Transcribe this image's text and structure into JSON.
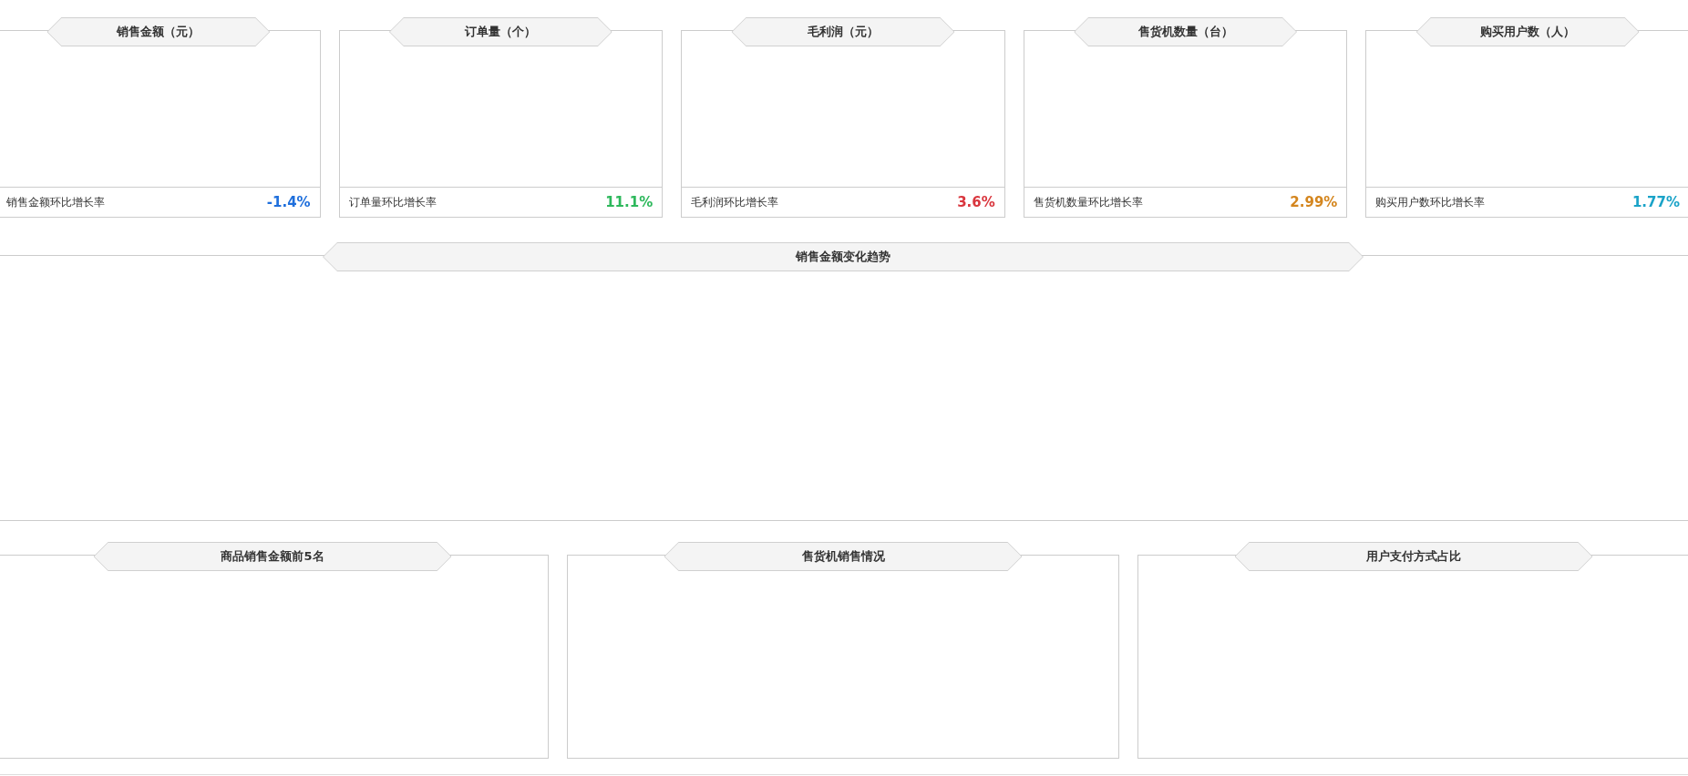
{
  "kpi_cards": [
    {
      "title": "销售金额（元）",
      "footer_label": "销售金额环比增长率",
      "growth": "-1.4%",
      "color": "#1f6fdc"
    },
    {
      "title": "订单量（个）",
      "footer_label": "订单量环比增长率",
      "growth": "11.1%",
      "color": "#2eb85c"
    },
    {
      "title": "毛利润（元）",
      "footer_label": "毛利润环比增长率",
      "growth": "3.6%",
      "color": "#d9363e"
    },
    {
      "title": "售货机数量（台）",
      "footer_label": "售货机数量环比增长率",
      "growth": "2.99%",
      "color": "#d4861f"
    },
    {
      "title": "购买用户数（人）",
      "footer_label": "购买用户数环比增长率",
      "growth": "1.77%",
      "color": "#1aa3c8"
    }
  ],
  "trend_panel": {
    "title": "销售金额变化趋势"
  },
  "bottom_panels": [
    {
      "title": "商品销售金额前5名"
    },
    {
      "title": "售货机销售情况"
    },
    {
      "title": "用户支付方式占比"
    }
  ]
}
